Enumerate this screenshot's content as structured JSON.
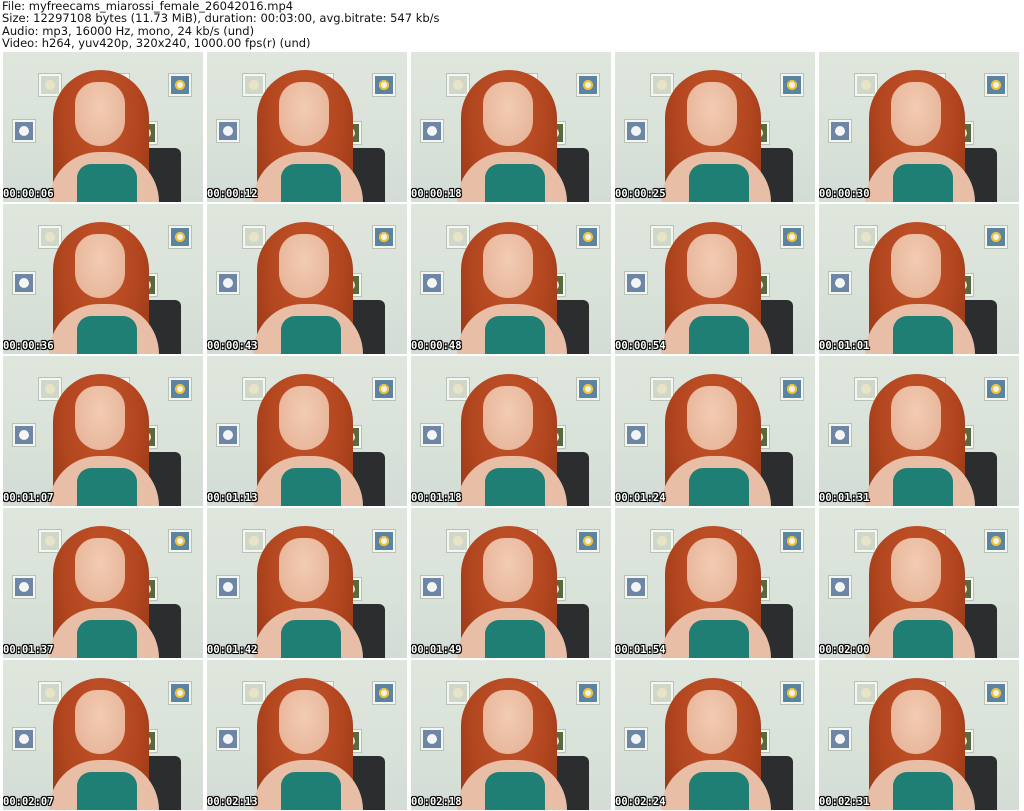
{
  "header": {
    "file_line": "File: myfreecams_miarossi_female_26042016.mp4",
    "size_line": "Size: 12297108 bytes (11.73 MiB), duration: 00:03:00, avg.bitrate: 547 kb/s",
    "audio_line": "Audio: mp3, 16000 Hz, mono, 24 kb/s (und)",
    "video_line": "Video: h264, yuv420p, 320x240, 1000.00 fps(r) (und)"
  },
  "thumbnails": [
    {
      "timestamp": "00:00:06"
    },
    {
      "timestamp": "00:00:12"
    },
    {
      "timestamp": "00:00:18"
    },
    {
      "timestamp": "00:00:25"
    },
    {
      "timestamp": "00:00:30"
    },
    {
      "timestamp": "00:00:36"
    },
    {
      "timestamp": "00:00:43"
    },
    {
      "timestamp": "00:00:48"
    },
    {
      "timestamp": "00:00:54"
    },
    {
      "timestamp": "00:01:01"
    },
    {
      "timestamp": "00:01:07"
    },
    {
      "timestamp": "00:01:13"
    },
    {
      "timestamp": "00:01:18"
    },
    {
      "timestamp": "00:01:24"
    },
    {
      "timestamp": "00:01:31"
    },
    {
      "timestamp": "00:01:37"
    },
    {
      "timestamp": "00:01:42"
    },
    {
      "timestamp": "00:01:49"
    },
    {
      "timestamp": "00:01:54"
    },
    {
      "timestamp": "00:02:00"
    },
    {
      "timestamp": "00:02:07"
    },
    {
      "timestamp": "00:02:13"
    },
    {
      "timestamp": "00:02:18"
    },
    {
      "timestamp": "00:02:24"
    },
    {
      "timestamp": "00:02:31"
    }
  ]
}
